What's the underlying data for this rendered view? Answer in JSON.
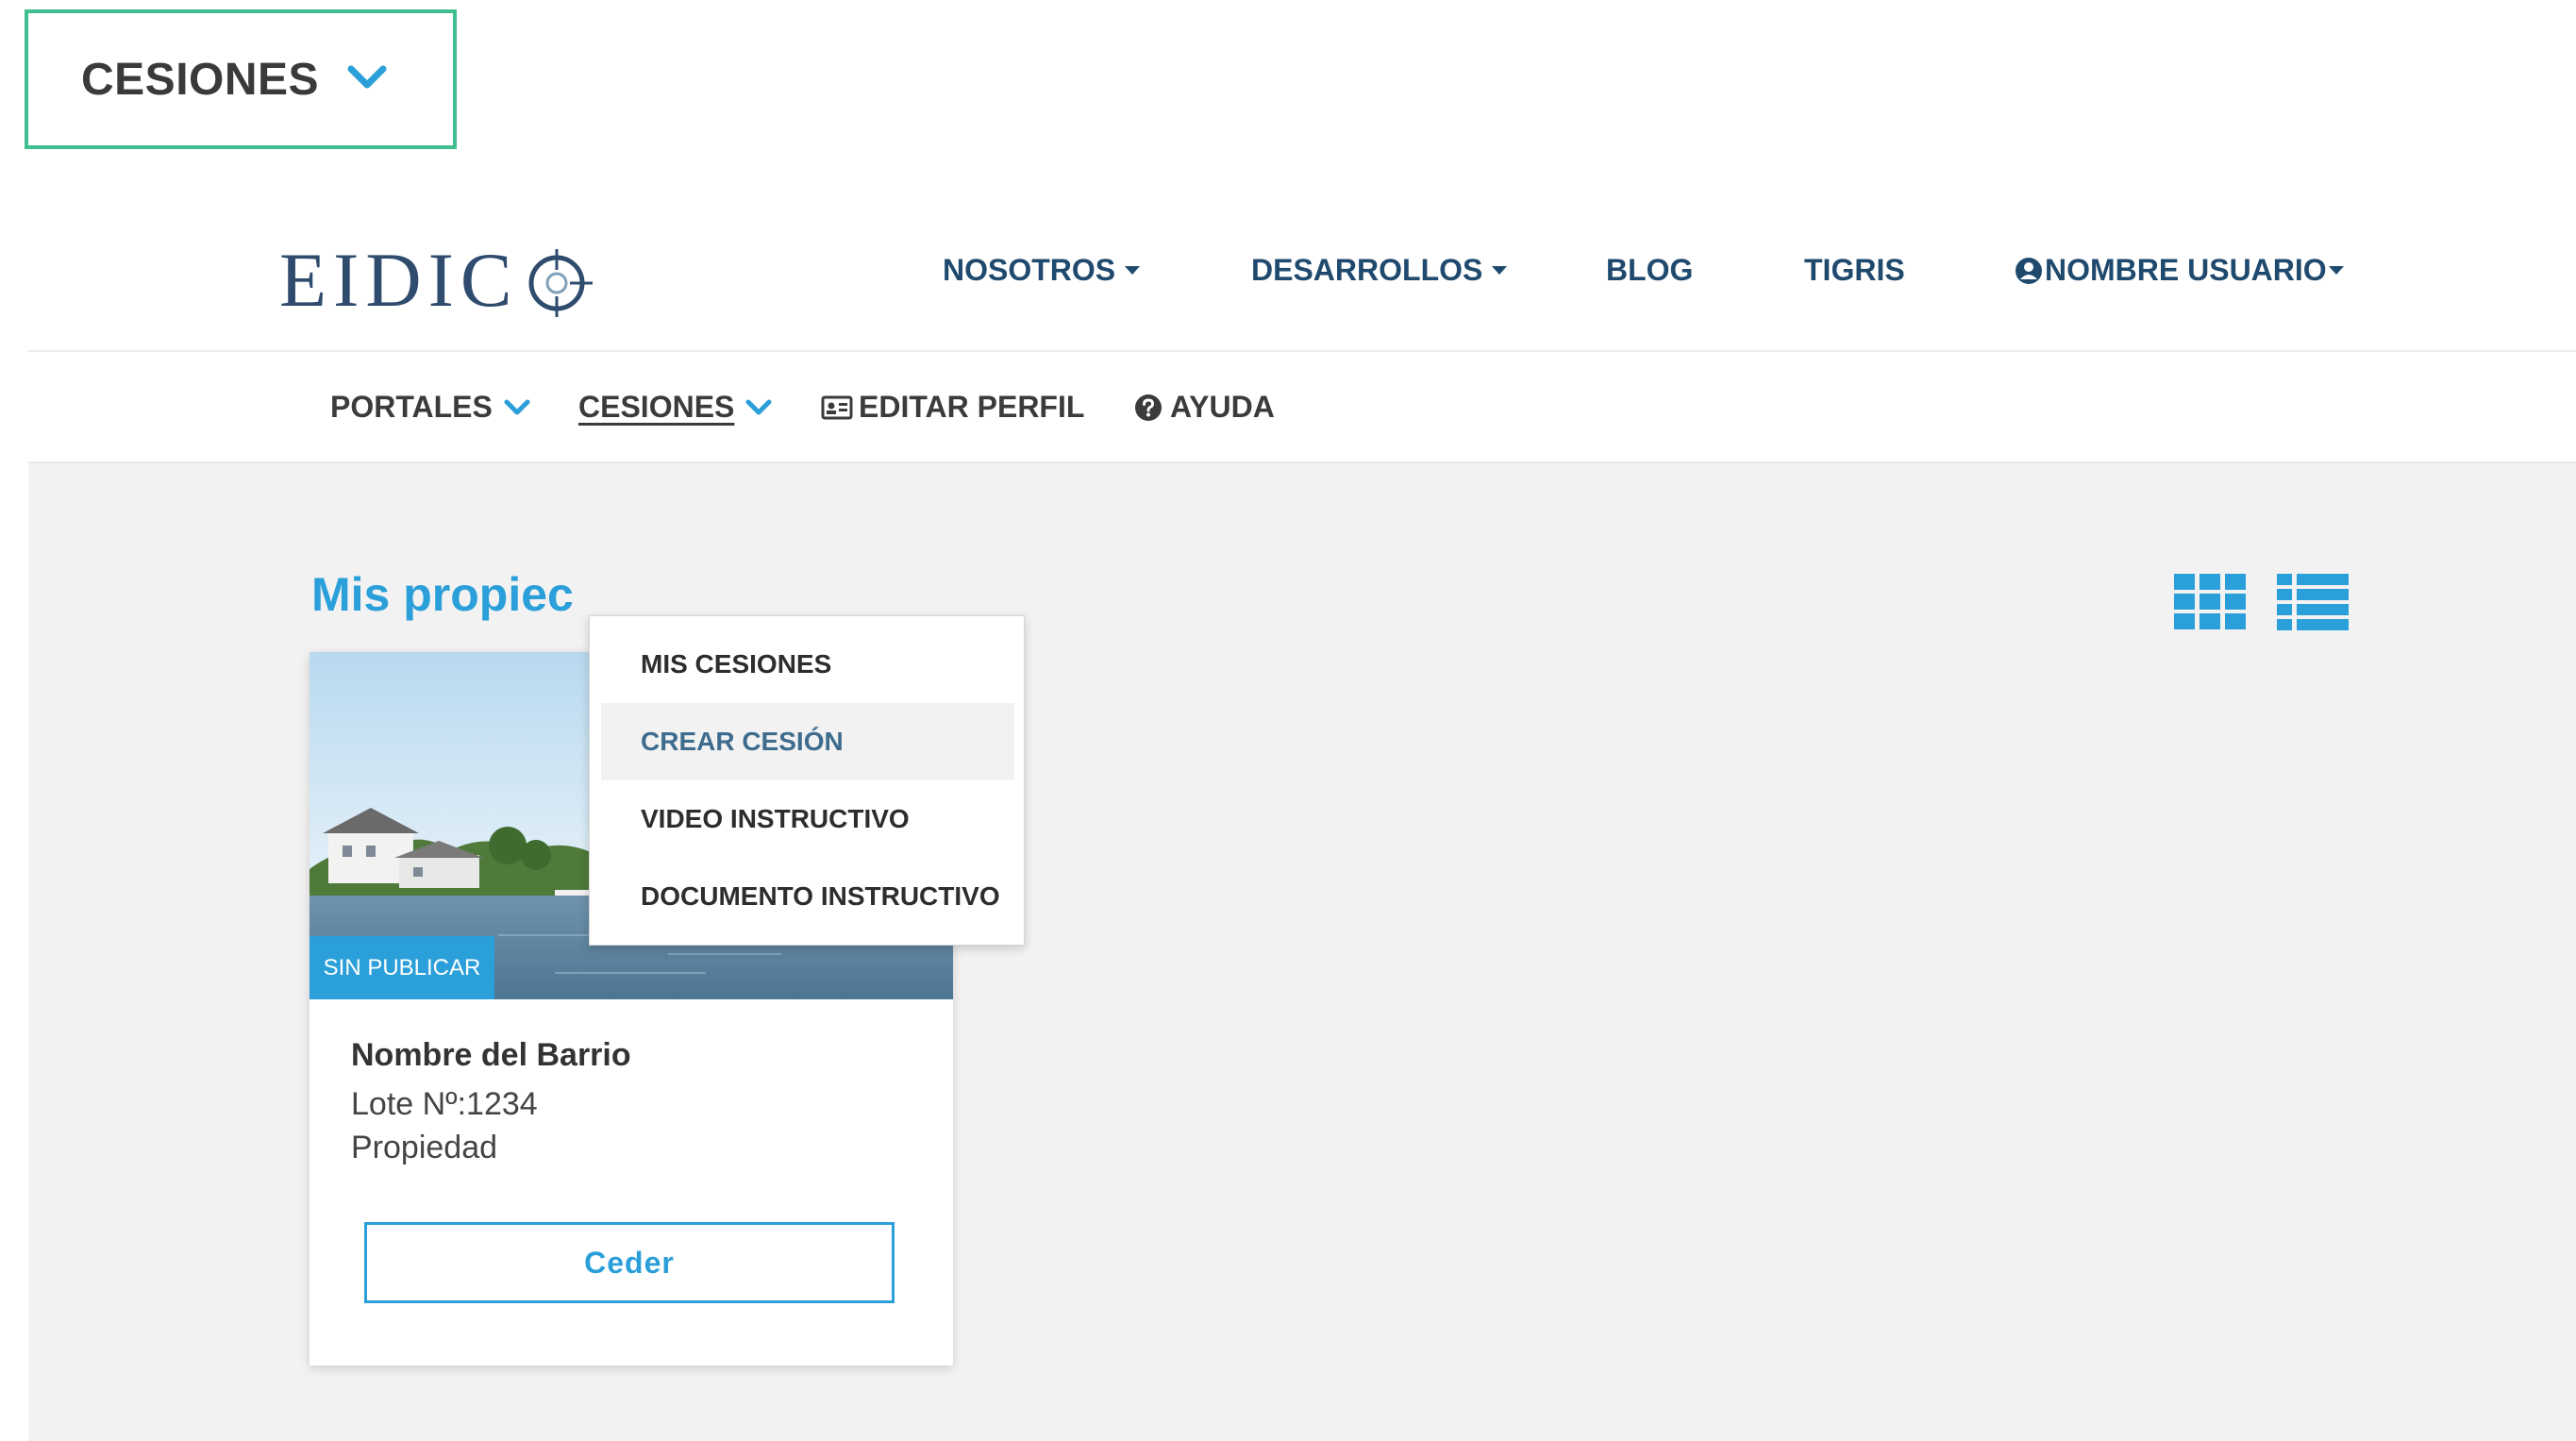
{
  "callout": {
    "label": "CESIONES"
  },
  "logo": {
    "text": "EIDIC"
  },
  "topnav": {
    "nosotros": "NOSOTROS",
    "desarrollos": "DESARROLLOS",
    "blog": "BLOG",
    "tigris": "TIGRIS",
    "user": "NOMBRE USUARIO"
  },
  "subnav": {
    "portales": "PORTALES",
    "cesiones": "CESIONES",
    "editar_perfil": "EDITAR PERFIL",
    "ayuda": "AYUDA"
  },
  "dropdown": {
    "items": [
      {
        "label": "MIS CESIONES"
      },
      {
        "label": "CREAR CESIÓN"
      },
      {
        "label": "VIDEO INSTRUCTIVO"
      },
      {
        "label": "DOCUMENTO INSTRUCTIVO"
      }
    ]
  },
  "content": {
    "title": "Mis propiec"
  },
  "card": {
    "badge": "SIN PUBLICAR",
    "title": "Nombre del Barrio",
    "lote": "Lote Nº:1234",
    "tipo": "Propiedad",
    "button": "Ceder"
  },
  "colors": {
    "accent": "#2b9fd9",
    "nav_text": "#1f4a6e",
    "callout_border": "#3fbf8f",
    "content_bg": "#f2f2f2"
  }
}
